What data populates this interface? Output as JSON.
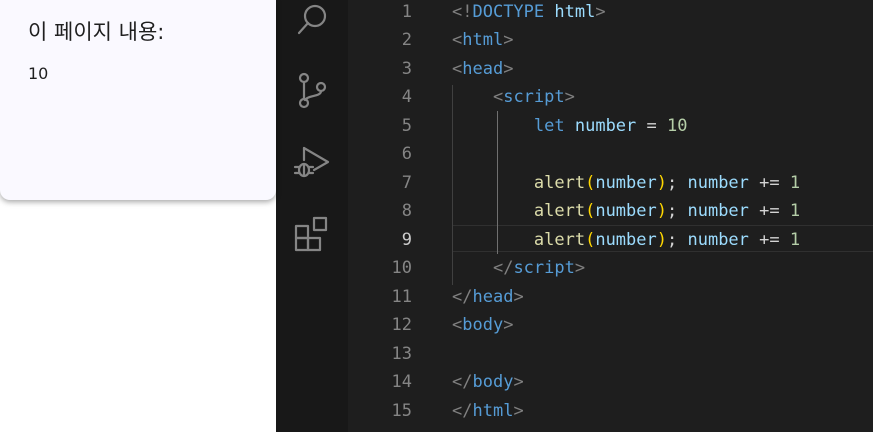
{
  "dialog": {
    "title": "이 페이지 내용:",
    "message": "10"
  },
  "activity_bar": {
    "icons": [
      "search-icon",
      "source-control-icon",
      "run-debug-icon",
      "extensions-icon"
    ]
  },
  "editor": {
    "active_line": 9,
    "line_numbers": [
      "1",
      "2",
      "3",
      "4",
      "5",
      "6",
      "7",
      "8",
      "9",
      "10",
      "11",
      "12",
      "13",
      "14",
      "15"
    ],
    "lines": [
      [
        {
          "t": "<!",
          "c": "br"
        },
        {
          "t": "DOCTYPE",
          "c": "doc"
        },
        {
          "t": " ",
          "c": "plain"
        },
        {
          "t": "html",
          "c": "var"
        },
        {
          "t": ">",
          "c": "br"
        }
      ],
      [
        {
          "t": "<",
          "c": "br"
        },
        {
          "t": "html",
          "c": "tag"
        },
        {
          "t": ">",
          "c": "br"
        }
      ],
      [
        {
          "t": "<",
          "c": "br"
        },
        {
          "t": "head",
          "c": "tag"
        },
        {
          "t": ">",
          "c": "br"
        }
      ],
      [
        {
          "t": "    ",
          "c": "plain"
        },
        {
          "t": "<",
          "c": "br"
        },
        {
          "t": "script",
          "c": "tag"
        },
        {
          "t": ">",
          "c": "br"
        }
      ],
      [
        {
          "t": "        ",
          "c": "plain"
        },
        {
          "t": "let",
          "c": "kw"
        },
        {
          "t": " ",
          "c": "plain"
        },
        {
          "t": "number",
          "c": "var"
        },
        {
          "t": " = ",
          "c": "plain"
        },
        {
          "t": "10",
          "c": "num"
        }
      ],
      [],
      [
        {
          "t": "        ",
          "c": "plain"
        },
        {
          "t": "alert",
          "c": "fn"
        },
        {
          "t": "(",
          "c": "paren"
        },
        {
          "t": "number",
          "c": "var"
        },
        {
          "t": ")",
          "c": "paren"
        },
        {
          "t": "; ",
          "c": "plain"
        },
        {
          "t": "number",
          "c": "var"
        },
        {
          "t": " += ",
          "c": "plain"
        },
        {
          "t": "1",
          "c": "num"
        }
      ],
      [
        {
          "t": "        ",
          "c": "plain"
        },
        {
          "t": "alert",
          "c": "fn"
        },
        {
          "t": "(",
          "c": "paren"
        },
        {
          "t": "number",
          "c": "var"
        },
        {
          "t": ")",
          "c": "paren"
        },
        {
          "t": "; ",
          "c": "plain"
        },
        {
          "t": "number",
          "c": "var"
        },
        {
          "t": " += ",
          "c": "plain"
        },
        {
          "t": "1",
          "c": "num"
        }
      ],
      [
        {
          "t": "        ",
          "c": "plain"
        },
        {
          "t": "alert",
          "c": "fn"
        },
        {
          "t": "(",
          "c": "paren"
        },
        {
          "t": "number",
          "c": "var"
        },
        {
          "t": ")",
          "c": "paren"
        },
        {
          "t": "; ",
          "c": "plain"
        },
        {
          "t": "number",
          "c": "var"
        },
        {
          "t": " += ",
          "c": "plain"
        },
        {
          "t": "1",
          "c": "num"
        }
      ],
      [
        {
          "t": "    ",
          "c": "plain"
        },
        {
          "t": "</",
          "c": "br"
        },
        {
          "t": "script",
          "c": "tag"
        },
        {
          "t": ">",
          "c": "br"
        }
      ],
      [
        {
          "t": "</",
          "c": "br"
        },
        {
          "t": "head",
          "c": "tag"
        },
        {
          "t": ">",
          "c": "br"
        }
      ],
      [
        {
          "t": "<",
          "c": "br"
        },
        {
          "t": "body",
          "c": "tag"
        },
        {
          "t": ">",
          "c": "br"
        }
      ],
      [],
      [
        {
          "t": "</",
          "c": "br"
        },
        {
          "t": "body",
          "c": "tag"
        },
        {
          "t": ">",
          "c": "br"
        }
      ],
      [
        {
          "t": "</",
          "c": "br"
        },
        {
          "t": "html",
          "c": "tag"
        },
        {
          "t": ">",
          "c": "br"
        }
      ]
    ]
  }
}
